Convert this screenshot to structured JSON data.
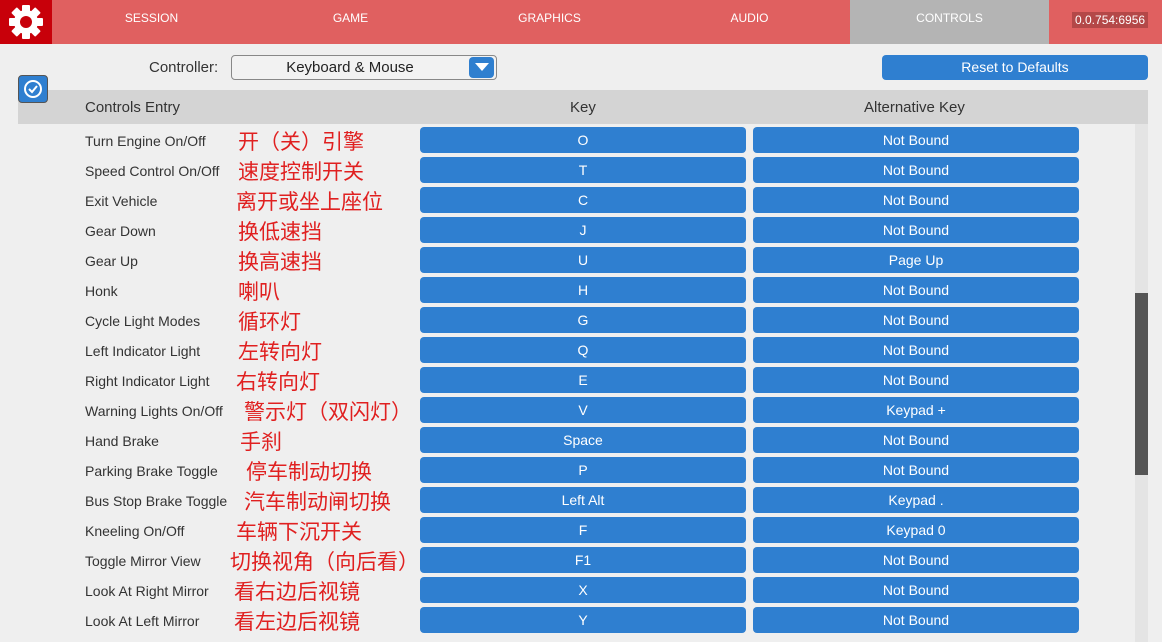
{
  "tabs": [
    "SESSION",
    "GAME",
    "GRAPHICS",
    "AUDIO",
    "CONTROLS"
  ],
  "active_tab": "CONTROLS",
  "version": "0.0.754:6956",
  "controller": {
    "label": "Controller:",
    "value": "Keyboard & Mouse"
  },
  "reset_label": "Reset to Defaults",
  "headers": {
    "entry": "Controls Entry",
    "key": "Key",
    "alt": "Alternative Key"
  },
  "rows": [
    {
      "entry": "Turn Engine On/Off",
      "note": "开（关）引擎",
      "key": "O",
      "alt": "Not Bound"
    },
    {
      "entry": "Speed Control On/Off",
      "note": "速度控制开关",
      "key": "T",
      "alt": "Not Bound"
    },
    {
      "entry": "Exit Vehicle",
      "note": "离开或坐上座位",
      "key": "C",
      "alt": "Not Bound"
    },
    {
      "entry": "Gear Down",
      "note": "换低速挡",
      "key": "J",
      "alt": "Not Bound"
    },
    {
      "entry": "Gear Up",
      "note": "换高速挡",
      "key": "U",
      "alt": "Page Up"
    },
    {
      "entry": "Honk",
      "note": "喇叭",
      "key": "H",
      "alt": "Not Bound"
    },
    {
      "entry": "Cycle Light Modes",
      "note": "循环灯",
      "key": "G",
      "alt": "Not Bound"
    },
    {
      "entry": "Left Indicator Light",
      "note": "左转向灯",
      "key": "Q",
      "alt": "Not Bound"
    },
    {
      "entry": "Right Indicator Light",
      "note": "右转向灯",
      "key": "E",
      "alt": "Not Bound"
    },
    {
      "entry": "Warning Lights On/Off",
      "note": "警示灯（双闪灯）",
      "key": "V",
      "alt": "Keypad +"
    },
    {
      "entry": "Hand Brake",
      "note": "手刹",
      "key": "Space",
      "alt": "Not Bound"
    },
    {
      "entry": "Parking Brake Toggle",
      "note": "停车制动切换",
      "key": "P",
      "alt": "Not Bound"
    },
    {
      "entry": "Bus Stop Brake Toggle",
      "note": "汽车制动闸切换",
      "key": "Left Alt",
      "alt": "Keypad ."
    },
    {
      "entry": "Kneeling On/Off",
      "note": "车辆下沉开关",
      "key": "F",
      "alt": "Keypad 0"
    },
    {
      "entry": "Toggle Mirror View",
      "note": "切换视角（向后看）",
      "key": "F1",
      "alt": "Not Bound"
    },
    {
      "entry": "Look At Right Mirror",
      "note": "看右边后视镜",
      "key": "X",
      "alt": "Not Bound"
    },
    {
      "entry": "Look At Left Mirror",
      "note": "看左边后视镜",
      "key": "Y",
      "alt": "Not Bound"
    }
  ],
  "colors": {
    "topbar": "#e06060",
    "accent": "#2f7fd0",
    "note": "#e02020"
  }
}
